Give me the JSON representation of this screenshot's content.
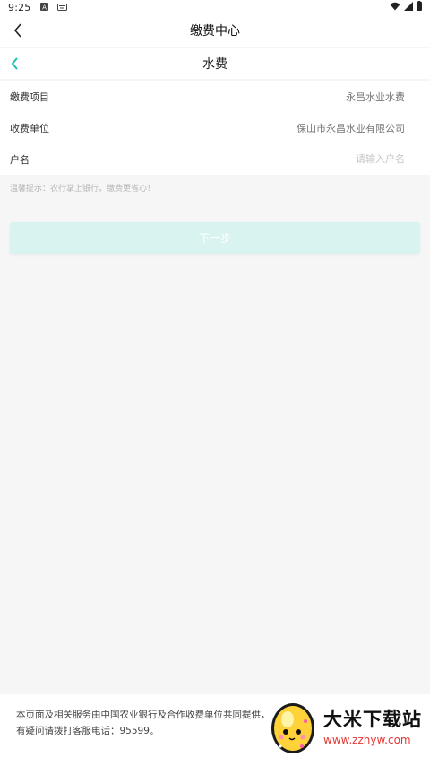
{
  "status": {
    "time": "9:25",
    "icons": [
      "a-icon",
      "keyboard-icon"
    ],
    "right_icons": [
      "wifi-icon",
      "signal-icon",
      "battery-icon"
    ]
  },
  "header": {
    "title": "缴费中心"
  },
  "subheader": {
    "title": "水费"
  },
  "form": {
    "rows": [
      {
        "label": "缴费项目",
        "value": "永昌水业水费"
      },
      {
        "label": "收费单位",
        "value": "保山市永昌水业有限公司"
      },
      {
        "label": "户名",
        "placeholder": "请输入户名"
      }
    ]
  },
  "tip": "温馨提示：农行掌上银行，缴费更省心！",
  "next_button": "下一步",
  "footer": {
    "text": "本页面及相关服务由中国农业银行及合作收费单位共同提供，如有疑问请拨打客服电话：95599。"
  },
  "watermark": {
    "title": "大米下载站",
    "url": "www.zzhyw.com"
  },
  "colors": {
    "accent": "#1cbfa8",
    "button_bg": "#d9f4f0"
  }
}
